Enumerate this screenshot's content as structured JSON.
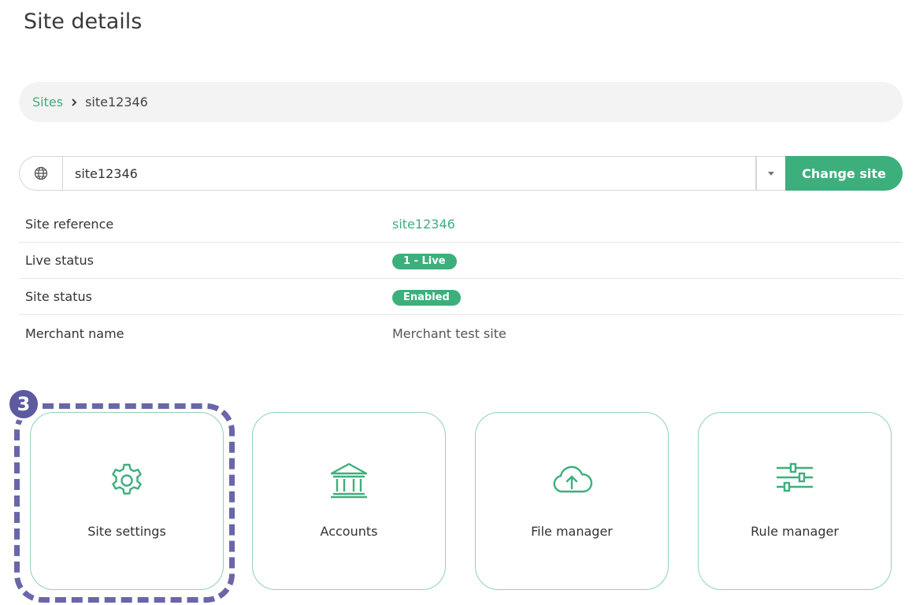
{
  "page": {
    "title": "Site details"
  },
  "breadcrumb": {
    "parent": "Sites",
    "separator": "›",
    "current": "site12346"
  },
  "site_select": {
    "value": "site12346",
    "button_label": "Change site"
  },
  "details": [
    {
      "label": "Site reference",
      "value": "site12346"
    },
    {
      "label": "Live status",
      "value": "1 - Live"
    },
    {
      "label": "Site status",
      "value": "Enabled"
    },
    {
      "label": "Merchant name",
      "value": "Merchant test site"
    }
  ],
  "tiles": [
    {
      "label": "Site settings",
      "icon": "gear-icon"
    },
    {
      "label": "Accounts",
      "icon": "bank-icon"
    },
    {
      "label": "File manager",
      "icon": "cloud-upload-icon"
    },
    {
      "label": "Rule manager",
      "icon": "sliders-icon"
    }
  ],
  "annotation": {
    "step": "3"
  },
  "colors": {
    "accent": "#3daf7c",
    "tile_border": "#8fd3b4",
    "highlight": "#6a66a8"
  }
}
